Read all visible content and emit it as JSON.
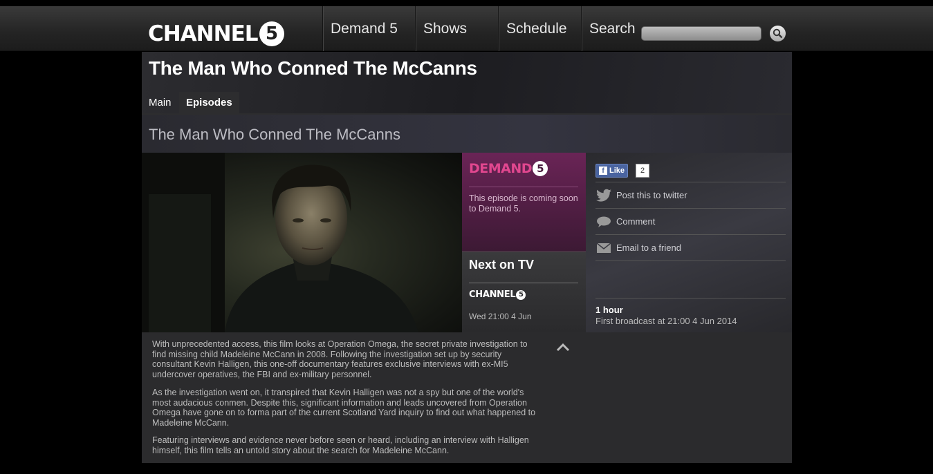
{
  "nav": {
    "logo_text": "CHANNEL",
    "logo_number": "5",
    "items": [
      {
        "label": "Demand 5"
      },
      {
        "label": "Shows"
      },
      {
        "label": "Schedule"
      },
      {
        "label": "Search"
      }
    ],
    "search_value": ""
  },
  "show": {
    "title": "The Man Who Conned The McCanns",
    "tabs": [
      {
        "label": "Main",
        "active": false
      },
      {
        "label": "Episodes",
        "active": true
      }
    ]
  },
  "episode": {
    "title": "The Man Who Conned The McCanns",
    "demand5": {
      "logo_text": "DEMAND",
      "logo_number": "5",
      "message": "This episode is coming soon to Demand 5."
    },
    "next_on_tv": {
      "heading": "Next on TV",
      "channel_text": "CHANNEL",
      "channel_number": "5",
      "time": "Wed 21:00 4 Jun"
    },
    "social": {
      "like_label": "Like",
      "like_count": "2",
      "twitter": "Post this to twitter",
      "comment": "Comment",
      "email": "Email to a friend"
    },
    "duration": "1 hour",
    "first_broadcast": "First broadcast at 21:00 4 Jun 2014",
    "description": [
      "With unprecedented access, this film looks at Operation Omega, the secret private investigation to find missing child Madeleine McCann in 2008. Following the investigation set up by security consultant Kevin Halligen, this one-off documentary features exclusive interviews with ex-MI5 undercover operatives, the FBI and ex-military personnel.",
      "As the investigation went on, it transpired that Kevin Halligen was not a spy but one of the world's most audacious conmen. Despite this, significant information and leads uncovered from Operation Omega have gone on to forma part of the current Scotland Yard inquiry to find out what happened to Madeleine McCann.",
      "Featuring interviews and evidence never before seen or heard, including an interview with Halligen himself, this film tells an untold story about the search for Madeleine McCann."
    ]
  },
  "colors": {
    "demand5_pink": "#e1478f",
    "demand5_bg": "#6a2456",
    "facebook_blue": "#4a64a0"
  }
}
